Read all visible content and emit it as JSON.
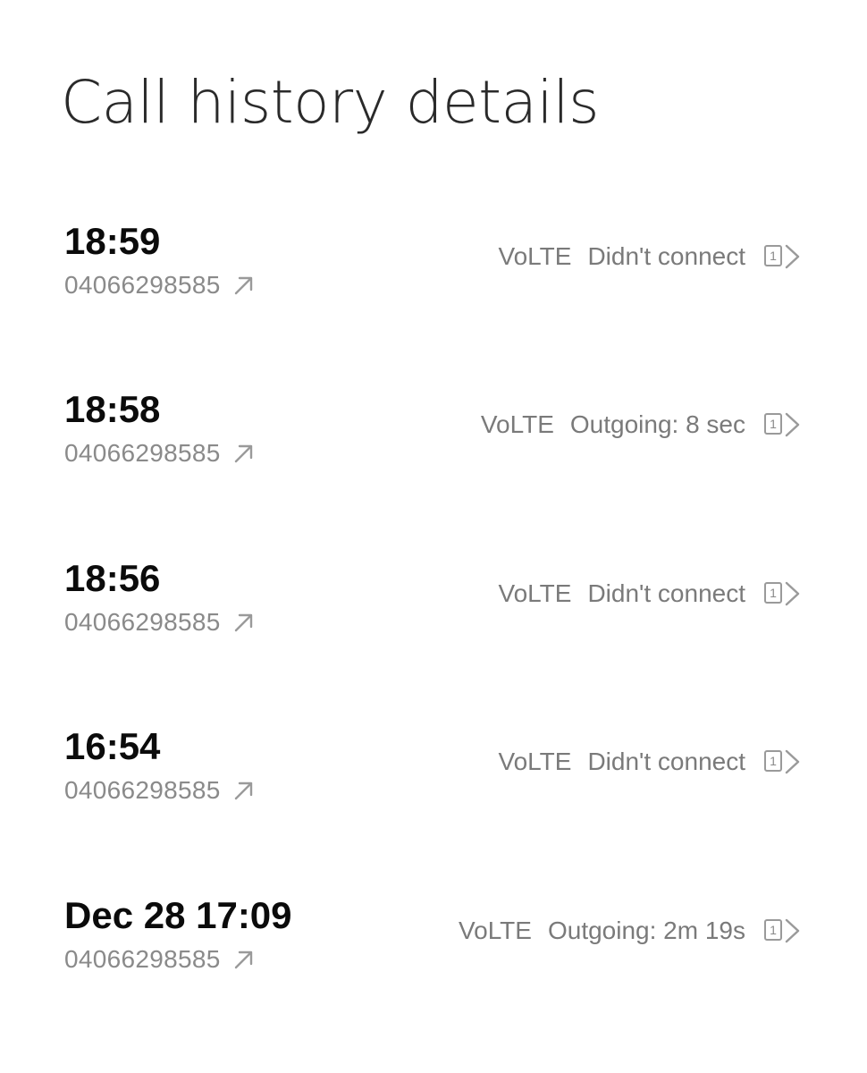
{
  "header": {
    "title": "Call history details"
  },
  "calls": [
    {
      "time": "18:59",
      "number": "04066298585",
      "network": "VoLTE",
      "status": "Didn't connect",
      "sim": "1",
      "direction_icon": "outgoing-arrow-icon"
    },
    {
      "time": "18:58",
      "number": "04066298585",
      "network": "VoLTE",
      "status": "Outgoing: 8 sec",
      "sim": "1",
      "direction_icon": "outgoing-arrow-icon"
    },
    {
      "time": "18:56",
      "number": "04066298585",
      "network": "VoLTE",
      "status": "Didn't connect",
      "sim": "1",
      "direction_icon": "outgoing-arrow-icon"
    },
    {
      "time": "16:54",
      "number": "04066298585",
      "network": "VoLTE",
      "status": "Didn't connect",
      "sim": "1",
      "direction_icon": "outgoing-arrow-icon"
    },
    {
      "time": "Dec 28 17:09",
      "number": "04066298585",
      "network": "VoLTE",
      "status": "Outgoing: 2m 19s",
      "sim": "1",
      "direction_icon": "outgoing-arrow-icon"
    }
  ],
  "colors": {
    "background": "#ffffff",
    "title": "#2a2a2a",
    "time": "#0b0b0b",
    "secondary_text": "#8a8a8a",
    "icon": "#9a9a9a"
  }
}
